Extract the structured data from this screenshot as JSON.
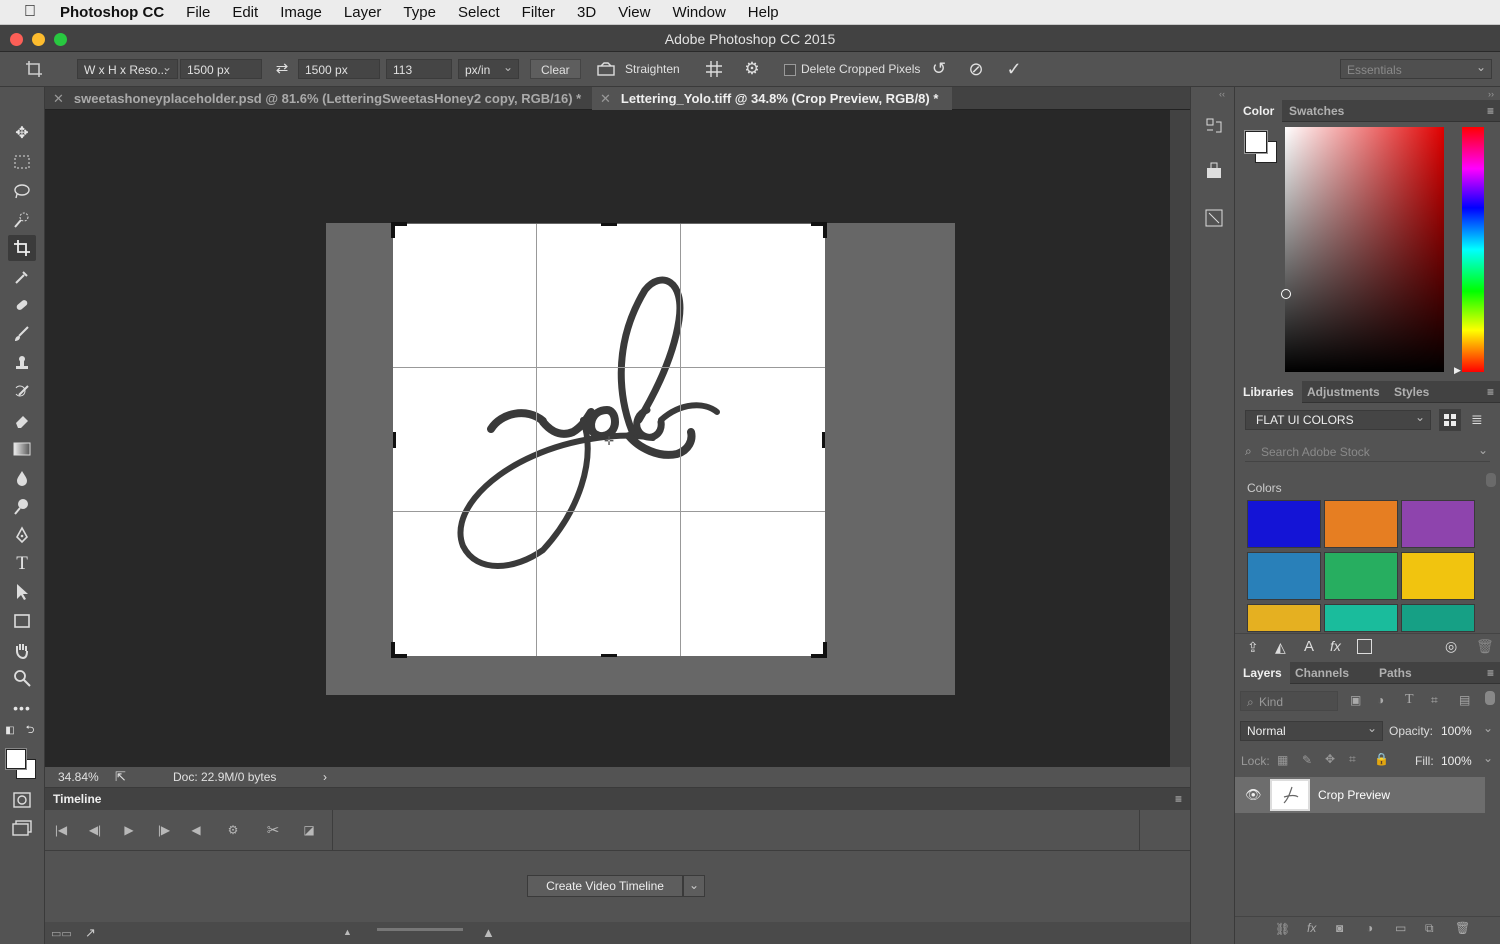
{
  "menubar": {
    "app": "Photoshop CC",
    "items": [
      "File",
      "Edit",
      "Image",
      "Layer",
      "Type",
      "Select",
      "Filter",
      "3D",
      "View",
      "Window",
      "Help"
    ]
  },
  "window": {
    "title": "Adobe Photoshop CC 2015"
  },
  "options": {
    "preset": "W x H x Reso...",
    "width": "1500 px",
    "height": "1500 px",
    "resolution": "113",
    "unit": "px/in",
    "clear": "Clear",
    "straighten": "Straighten",
    "delete_cropped": "Delete Cropped Pixels",
    "workspace": "Essentials"
  },
  "tabs": [
    {
      "label": "sweetashoneyplaceholder.psd @ 81.6% (LetteringSweetasHoney2 copy, RGB/16) *"
    },
    {
      "label": "Lettering_Yolo.tiff @ 34.8% (Crop Preview, RGB/8) *"
    }
  ],
  "status": {
    "zoom": "34.84%",
    "doc": "Doc: 22.9M/0 bytes"
  },
  "timeline": {
    "title": "Timeline",
    "create_button": "Create Video Timeline"
  },
  "color_panel": {
    "tabs": [
      "Color",
      "Swatches"
    ]
  },
  "libraries_panel": {
    "tabs": [
      "Libraries",
      "Adjustments",
      "Styles"
    ],
    "library": "FLAT UI COLORS",
    "search_placeholder": "Search Adobe Stock",
    "colors_label": "Colors",
    "swatches": [
      "#1414d6",
      "#e67e22",
      "#8e44ad",
      "#2980b9",
      "#27ae60",
      "#f1c40f",
      "#e5b021",
      "#1abc9c",
      "#16a085"
    ]
  },
  "layers_panel": {
    "tabs": [
      "Layers",
      "Channels",
      "Paths"
    ],
    "filter": "Kind",
    "blend_mode": "Normal",
    "opacity_label": "Opacity:",
    "opacity": "100%",
    "lock_label": "Lock:",
    "fill_label": "Fill:",
    "fill": "100%",
    "layers": [
      {
        "name": "Crop Preview"
      }
    ]
  }
}
